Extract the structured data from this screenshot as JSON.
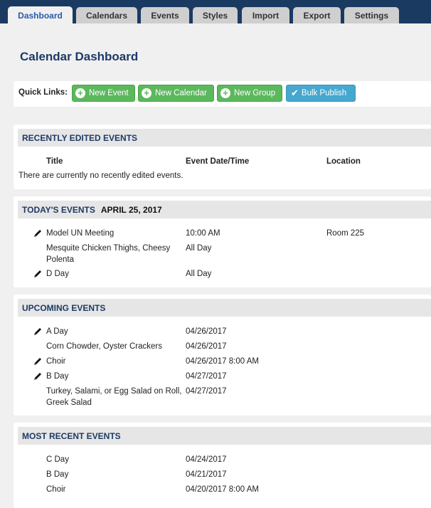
{
  "tabs": [
    {
      "label": "Dashboard",
      "active": true
    },
    {
      "label": "Calendars"
    },
    {
      "label": "Events"
    },
    {
      "label": "Styles"
    },
    {
      "label": "Import"
    },
    {
      "label": "Export"
    },
    {
      "label": "Settings"
    }
  ],
  "page_title": "Calendar Dashboard",
  "quick_links": {
    "label": "Quick Links:",
    "buttons": [
      {
        "label": "New Event",
        "icon": "plus-circle-icon"
      },
      {
        "label": "New Calendar",
        "icon": "plus-circle-icon"
      },
      {
        "label": "New Group",
        "icon": "plus-circle-icon"
      },
      {
        "label": "Bulk Publish",
        "icon": "check-icon"
      }
    ]
  },
  "recently_edited": {
    "title": "RECENTLY EDITED EVENTS",
    "columns": [
      "Title",
      "Event Date/Time",
      "Location"
    ],
    "empty_message": "There are currently no recently edited events."
  },
  "today": {
    "title": "TODAY'S EVENTS",
    "date": "APRIL 25, 2017",
    "rows": [
      {
        "editable": true,
        "title": "Model UN Meeting",
        "time": "10:00 AM",
        "location": "Room 225"
      },
      {
        "editable": false,
        "title_line1": "Mesquite Chicken Thighs, Cheesy",
        "title_line2": "Polenta",
        "time": "All Day",
        "location": ""
      },
      {
        "editable": true,
        "title": "D Day",
        "time": "All Day",
        "location": ""
      }
    ]
  },
  "upcoming": {
    "title": "UPCOMING EVENTS",
    "rows": [
      {
        "editable": true,
        "title": "A Day",
        "time": "04/26/2017"
      },
      {
        "editable": false,
        "title": "Corn Chowder, Oyster Crackers",
        "time": "04/26/2017"
      },
      {
        "editable": true,
        "title": "Choir",
        "time": "04/26/2017 8:00 AM"
      },
      {
        "editable": true,
        "title": "B Day",
        "time": "04/27/2017"
      },
      {
        "editable": false,
        "title_line1": "Turkey, Salami, or Egg Salad on Roll,",
        "title_line2": "Greek Salad",
        "time": "04/27/2017"
      }
    ]
  },
  "most_recent": {
    "title": "MOST RECENT EVENTS",
    "rows": [
      {
        "title": "C Day",
        "time": "04/24/2017"
      },
      {
        "title": "B Day",
        "time": "04/21/2017"
      },
      {
        "title": "Choir",
        "time": "04/20/2017 8:00 AM"
      }
    ]
  }
}
